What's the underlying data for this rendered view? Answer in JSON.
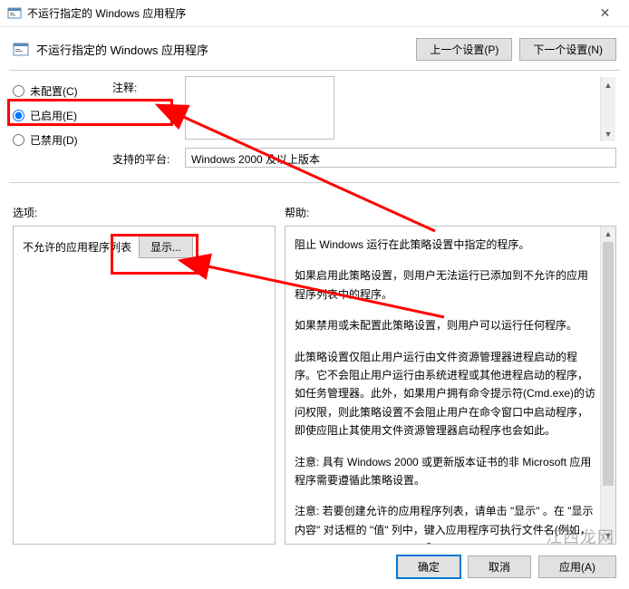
{
  "titlebar": {
    "title": "不运行指定的 Windows 应用程序",
    "close_label": "✕"
  },
  "header": {
    "title": "不运行指定的 Windows 应用程序",
    "prev_btn": "上一个设置(P)",
    "next_btn": "下一个设置(N)"
  },
  "radios": {
    "not_configured": "未配置(C)",
    "enabled": "已启用(E)",
    "disabled": "已禁用(D)"
  },
  "fields": {
    "comment_label": "注释:",
    "platform_label": "支持的平台:",
    "platform_value": "Windows 2000 及以上版本"
  },
  "sections": {
    "options_label": "选项:",
    "help_label": "帮助:"
  },
  "options": {
    "list_label": "不允许的应用程序列表",
    "show_btn": "显示..."
  },
  "help": {
    "p1": "阻止 Windows 运行在此策略设置中指定的程序。",
    "p2": "如果启用此策略设置，则用户无法运行已添加到不允许的应用程序列表中的程序。",
    "p3": "如果禁用或未配置此策略设置，则用户可以运行任何程序。",
    "p4": "此策略设置仅阻止用户运行由文件资源管理器进程启动的程序。它不会阻止用户运行由系统进程或其他进程启动的程序，如任务管理器。此外，如果用户拥有命令提示符(Cmd.exe)的访问权限，则此策略设置不会阻止用户在命令窗口中启动程序，即使应阻止其使用文件资源管理器启动程序也会如此。",
    "p5": "注意: 具有 Windows 2000 或更新版本证书的非 Microsoft 应用程序需要遵循此策略设置。",
    "p6": "注意: 若要创建允许的应用程序列表，请单击 \"显示\" 。在 \"显示内容\" 对话框的 \"值\" 列中，键入应用程序可执行文件名(例如，Winword.exe、Poledit.exe 和 Powerpnt.exe)。"
  },
  "footer": {
    "ok": "确定",
    "cancel": "取消",
    "apply": "应用(A)"
  },
  "watermark": "江西龙网"
}
